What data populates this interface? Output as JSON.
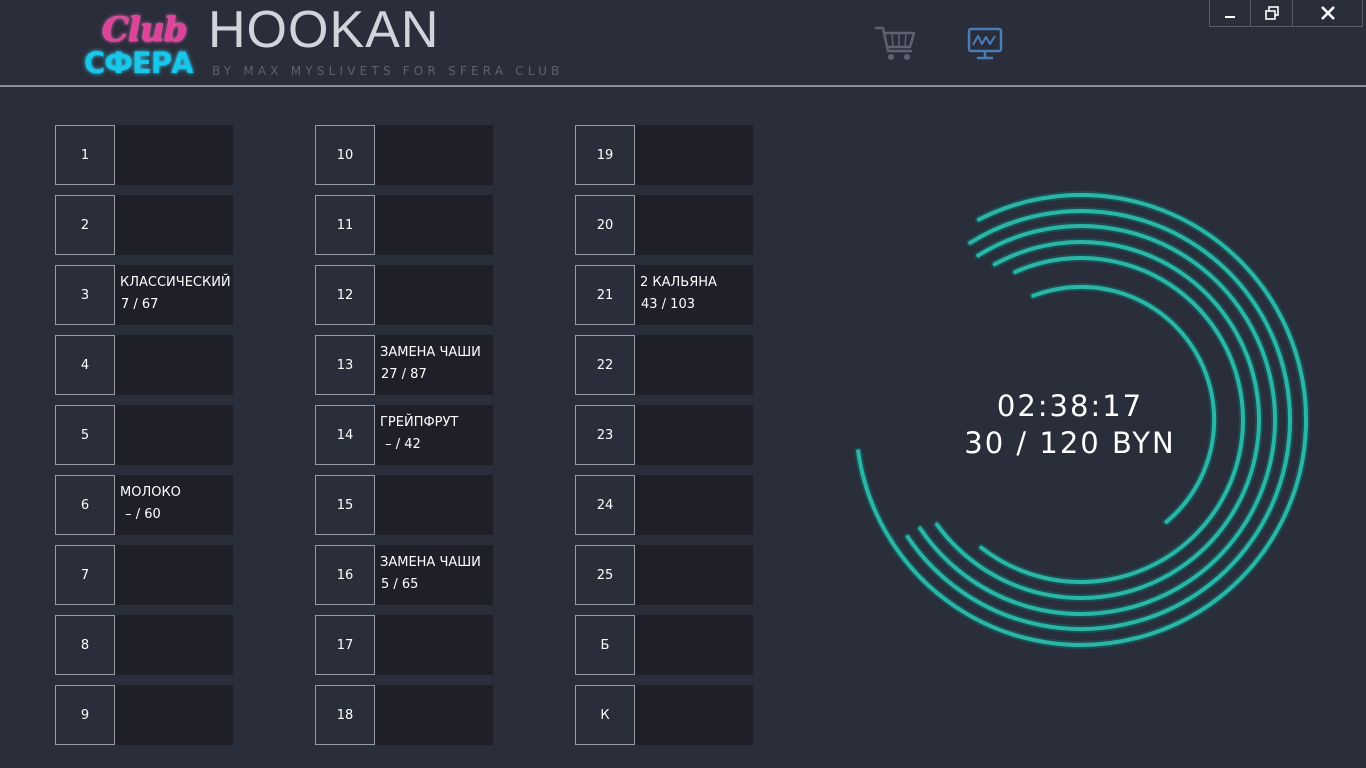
{
  "header": {
    "logo": {
      "top_text": "Club",
      "bottom_text": "СФЕРА"
    },
    "title": "HOOKAN",
    "subtitle": "BY MAX MYSLIVETS FOR SFERA CLUB",
    "icons": {
      "cart": "cart-icon",
      "monitor": "monitor-chart-icon"
    }
  },
  "window_controls": {
    "minimize": "minimize-icon",
    "restore": "restore-icon",
    "close": "close-icon"
  },
  "tables": [
    {
      "number": "1",
      "name": "",
      "price": ""
    },
    {
      "number": "2",
      "name": "",
      "price": ""
    },
    {
      "number": "3",
      "name": "КЛАССИЧЕСКИЙ",
      "price": "7 / 67"
    },
    {
      "number": "4",
      "name": "",
      "price": ""
    },
    {
      "number": "5",
      "name": "",
      "price": ""
    },
    {
      "number": "6",
      "name": "МОЛОКО",
      "price": " – / 60"
    },
    {
      "number": "7",
      "name": "",
      "price": ""
    },
    {
      "number": "8",
      "name": "",
      "price": ""
    },
    {
      "number": "9",
      "name": "",
      "price": ""
    },
    {
      "number": "10",
      "name": "",
      "price": ""
    },
    {
      "number": "11",
      "name": "",
      "price": ""
    },
    {
      "number": "12",
      "name": "",
      "price": ""
    },
    {
      "number": "13",
      "name": "ЗАМЕНА ЧАШИ",
      "price": "27 / 87"
    },
    {
      "number": "14",
      "name": "ГРЕЙПФРУТ",
      "price": " – / 42"
    },
    {
      "number": "15",
      "name": "",
      "price": ""
    },
    {
      "number": "16",
      "name": "ЗАМЕНА ЧАШИ",
      "price": "5 / 65"
    },
    {
      "number": "17",
      "name": "",
      "price": ""
    },
    {
      "number": "18",
      "name": "",
      "price": ""
    },
    {
      "number": "19",
      "name": "",
      "price": ""
    },
    {
      "number": "20",
      "name": "",
      "price": ""
    },
    {
      "number": "21",
      "name": "2 КАЛЬЯНА",
      "price": "43 / 103"
    },
    {
      "number": "22",
      "name": "",
      "price": ""
    },
    {
      "number": "23",
      "name": "",
      "price": ""
    },
    {
      "number": "24",
      "name": "",
      "price": ""
    },
    {
      "number": "25",
      "name": "",
      "price": ""
    },
    {
      "number": "Б",
      "name": "",
      "price": ""
    },
    {
      "number": "К",
      "name": "",
      "price": ""
    }
  ],
  "summary": {
    "timer": "02:38:17",
    "total": "30 / 120 BYN",
    "arc_color": "#2bb5a6"
  },
  "colors": {
    "background": "#2a2d3a",
    "cell_background": "#1e1f29",
    "cell_border": "#9a9ca5",
    "accent": "#2bb5a6"
  }
}
